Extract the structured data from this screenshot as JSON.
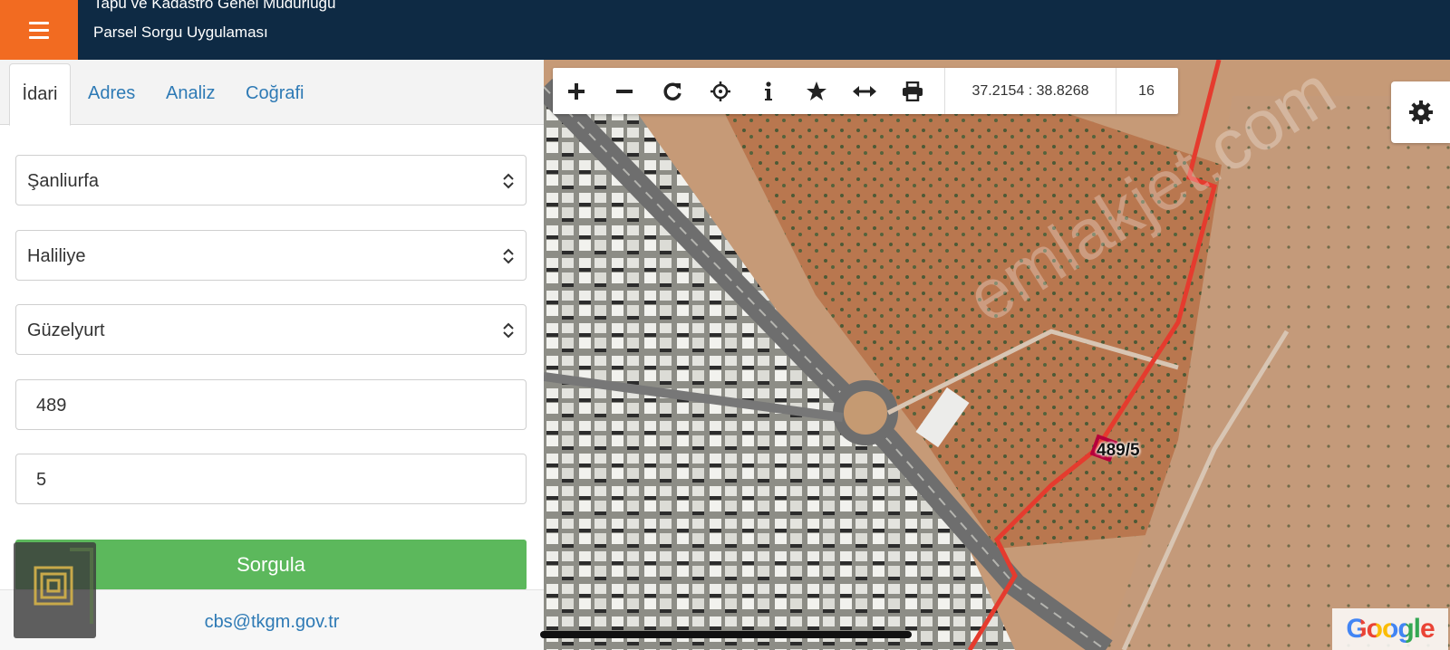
{
  "header": {
    "title": "Tapu ve Kadastro Genel Müdürlüğü",
    "subtitle": "Parsel Sorgu Uygulaması"
  },
  "tabs": [
    {
      "label": "İdari"
    },
    {
      "label": "Adres"
    },
    {
      "label": "Analiz"
    },
    {
      "label": "Coğrafi"
    }
  ],
  "form": {
    "province": "Şanliurfa",
    "district": "Haliliye",
    "neighborhood": "Güzelyurt",
    "block": "489",
    "parcel": "5",
    "submit_label": "Sorgula"
  },
  "footer": {
    "email": "cbs@tkgm.gov.tr"
  },
  "map": {
    "coordinates": "37.2154 : 38.8268",
    "zoom_level": "16",
    "parcel_label": "489/5",
    "attribution": "Google",
    "watermark": "emlakjet.com"
  },
  "colors": {
    "header_bg": "#0e2a44",
    "menu_accent": "#f26b21",
    "button_green": "#5cb85c",
    "link_blue": "#2e7ab5",
    "boundary_red": "#e53b2e"
  },
  "icons": [
    "menu-icon",
    "zoom-in-icon",
    "zoom-out-icon",
    "refresh-icon",
    "locate-icon",
    "info-icon",
    "star-icon",
    "measure-icon",
    "print-icon",
    "settings-gear-icon",
    "chevron-updown-icon"
  ]
}
